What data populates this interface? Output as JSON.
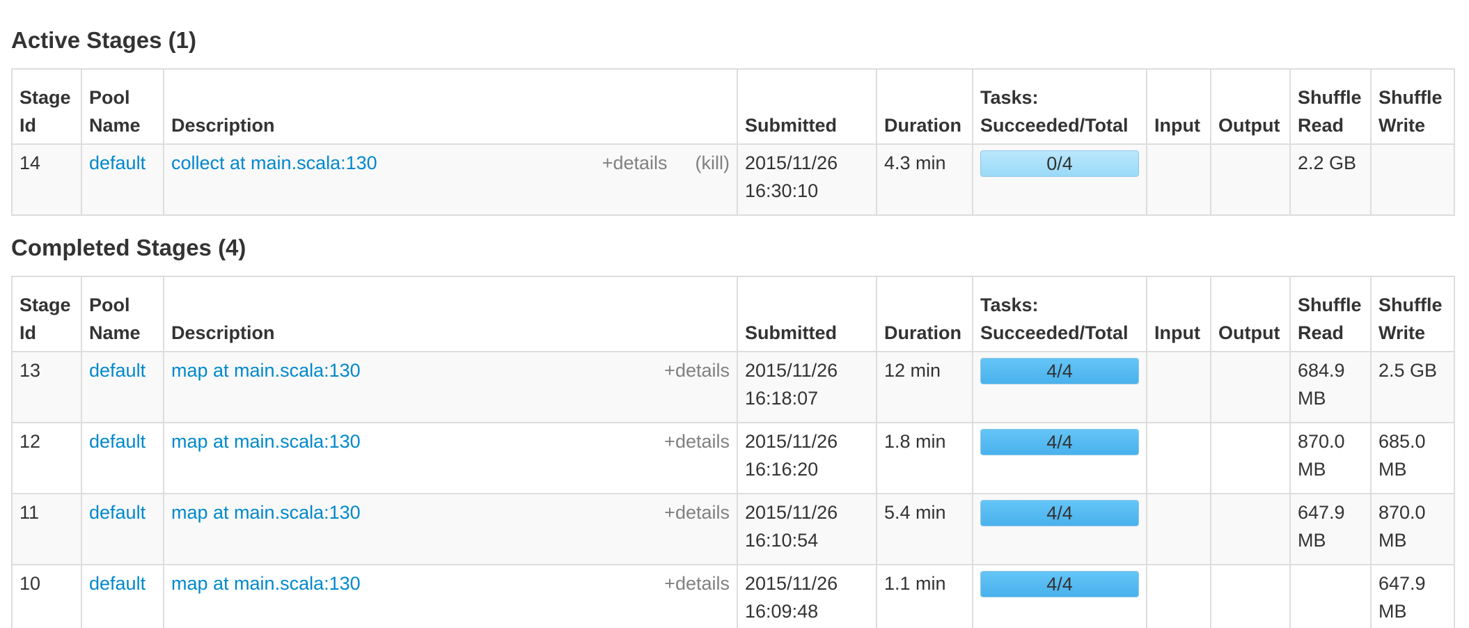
{
  "active": {
    "heading": "Active Stages (1)",
    "columns": [
      "Stage Id",
      "Pool Name",
      "Description",
      "Submitted",
      "Duration",
      "Tasks: Succeeded/Total",
      "Input",
      "Output",
      "Shuffle Read",
      "Shuffle Write"
    ],
    "rows": [
      {
        "stage_id": "14",
        "pool": "default",
        "description": "collect at main.scala:130",
        "details_label": "+details",
        "kill_label": "(kill)",
        "submitted_date": "2015/11/26",
        "submitted_time": "16:30:10",
        "duration": "4.3 min",
        "tasks_label": "0/4",
        "tasks_completed": 0,
        "tasks_running": 4,
        "tasks_total": 4,
        "input": "",
        "output": "",
        "shuffle_read_1": "2.2 GB",
        "shuffle_read_2": "",
        "shuffle_write_1": "",
        "shuffle_write_2": ""
      }
    ]
  },
  "completed": {
    "heading": "Completed Stages (4)",
    "columns": [
      "Stage Id",
      "Pool Name",
      "Description",
      "Submitted",
      "Duration",
      "Tasks: Succeeded/Total",
      "Input",
      "Output",
      "Shuffle Read",
      "Shuffle Write"
    ],
    "rows": [
      {
        "stage_id": "13",
        "pool": "default",
        "description": "map at main.scala:130",
        "details_label": "+details",
        "submitted_date": "2015/11/26",
        "submitted_time": "16:18:07",
        "duration": "12 min",
        "tasks_label": "4/4",
        "tasks_completed": 4,
        "tasks_total": 4,
        "input": "",
        "output": "",
        "shuffle_read_1": "684.9",
        "shuffle_read_2": "MB",
        "shuffle_write_1": "2.5 GB",
        "shuffle_write_2": ""
      },
      {
        "stage_id": "12",
        "pool": "default",
        "description": "map at main.scala:130",
        "details_label": "+details",
        "submitted_date": "2015/11/26",
        "submitted_time": "16:16:20",
        "duration": "1.8 min",
        "tasks_label": "4/4",
        "tasks_completed": 4,
        "tasks_total": 4,
        "input": "",
        "output": "",
        "shuffle_read_1": "870.0",
        "shuffle_read_2": "MB",
        "shuffle_write_1": "685.0",
        "shuffle_write_2": "MB"
      },
      {
        "stage_id": "11",
        "pool": "default",
        "description": "map at main.scala:130",
        "details_label": "+details",
        "submitted_date": "2015/11/26",
        "submitted_time": "16:10:54",
        "duration": "5.4 min",
        "tasks_label": "4/4",
        "tasks_completed": 4,
        "tasks_total": 4,
        "input": "",
        "output": "",
        "shuffle_read_1": "647.9",
        "shuffle_read_2": "MB",
        "shuffle_write_1": "870.0",
        "shuffle_write_2": "MB"
      },
      {
        "stage_id": "10",
        "pool": "default",
        "description": "map at main.scala:130",
        "details_label": "+details",
        "submitted_date": "2015/11/26",
        "submitted_time": "16:09:48",
        "duration": "1.1 min",
        "tasks_label": "4/4",
        "tasks_completed": 4,
        "tasks_total": 4,
        "input": "",
        "output": "",
        "shuffle_read_1": "",
        "shuffle_read_2": "",
        "shuffle_write_1": "647.9",
        "shuffle_write_2": "MB"
      }
    ]
  },
  "colors": {
    "link": "#0088cc",
    "text": "#333333",
    "muted": "#808080",
    "border": "#dddddd",
    "progress_complete": "#49b1ec",
    "progress_running": "#9adaf8"
  }
}
